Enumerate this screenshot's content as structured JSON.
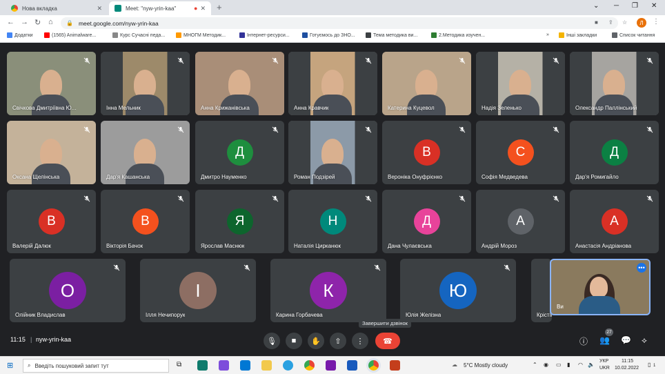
{
  "browser": {
    "tabs": [
      {
        "label": "Нова вкладка",
        "active": false
      },
      {
        "label": "Meet: \"nyw-yrin-kaa\"",
        "active": true
      }
    ],
    "url": "meet.google.com/nyw-yrin-kaa",
    "profile_initial": "Л",
    "bookmarks": [
      {
        "label": "Додатки",
        "color": "#4285f4"
      },
      {
        "label": "(1565) Animalware...",
        "color": "#ff0000"
      },
      {
        "label": "Курс Сучасні педа...",
        "color": "#888888"
      },
      {
        "label": "МНОГМ Методик...",
        "color": "#ff9900"
      },
      {
        "label": "Інтернет-ресурси...",
        "color": "#333399"
      },
      {
        "label": "Готуємось до ЗНО...",
        "color": "#1e4fa0"
      },
      {
        "label": "Тема методика ви...",
        "color": "#3c4043"
      },
      {
        "label": "2.Методика изучен...",
        "color": "#2e7d32"
      },
      {
        "label": "Інші закладки",
        "color": "#f4b400"
      },
      {
        "label": "Список читання",
        "color": "#5f6368"
      }
    ]
  },
  "meet": {
    "participants_video": [
      {
        "name": "Свічкова Дмитріївна Ю...",
        "bg": "#8a8f7a"
      },
      {
        "name": "Інна Мельник",
        "bg": "#9d8a6a"
      },
      {
        "name": "Анна Крижанівська",
        "bg": "#a98e78"
      },
      {
        "name": "Анна Кравчик",
        "bg": "#c5a47e"
      },
      {
        "name": "Катерина Куцевол",
        "bg": "#b9a48a"
      },
      {
        "name": "Надія Зеленько",
        "bg": "#b5b1a6"
      },
      {
        "name": "Олександр Паллінський",
        "bg": "#a6a4a0"
      },
      {
        "name": "Оксана Щелінська",
        "bg": "#c4b29a"
      },
      {
        "name": "Дар'я Кашанська",
        "bg": "#9c9c9c"
      },
      {
        "name": "Роман Подзірей",
        "bg": "#8c9aa8"
      }
    ],
    "participants_avatar": [
      {
        "name": "Дмитро Науменко",
        "letter": "Д",
        "color": "#1e8e3e"
      },
      {
        "name": "Вероніка Онуфрієнко",
        "letter": "В",
        "color": "#d93025"
      },
      {
        "name": "Софія Медведева",
        "letter": "С",
        "color": "#f4511e"
      },
      {
        "name": "Дар'я Ромигайло",
        "letter": "Д",
        "color": "#0b8043"
      },
      {
        "name": "Валерій Далюк",
        "letter": "В",
        "color": "#d93025"
      },
      {
        "name": "Вікторія Бачок",
        "letter": "В",
        "color": "#f4511e"
      },
      {
        "name": "Ярослав Маснюк",
        "letter": "Я",
        "color": "#0d652d"
      },
      {
        "name": "Наталія Цирканюк",
        "letter": "Н",
        "color": "#00897b"
      },
      {
        "name": "Дана Чулаєвська",
        "letter": "Д",
        "color": "#e8439a"
      },
      {
        "name": "Андрій Мороз",
        "letter": "А",
        "color": "#5f6368"
      },
      {
        "name": "Анастасія Андріанова",
        "letter": "А",
        "color": "#d93025"
      },
      {
        "name": "Олійник Владислав",
        "letter": "О",
        "color": "#7b1fa2"
      },
      {
        "name": "Ілля Нечипорук",
        "letter": "І",
        "color": "#8d6e63"
      },
      {
        "name": "Карина Горбачева",
        "letter": "К",
        "color": "#8e24aa"
      },
      {
        "name": "Юлія Желізна",
        "letter": "Ю",
        "color": "#1565c0"
      },
      {
        "name": "Крістіна",
        "letter": "",
        "color": "#3c4043"
      }
    ],
    "self_view": {
      "name": "Ви"
    },
    "time": "11:15",
    "meeting_code": "nyw-yrin-kaa",
    "end_call_tooltip": "Завершити дзвінок",
    "participant_count": "27"
  },
  "taskbar": {
    "search_placeholder": "Введіть пошуковий запит тут",
    "weather": "5°C  Mostly cloudy",
    "lang_top": "УКР",
    "lang_bottom": "UKR",
    "clock_time": "11:15",
    "clock_date": "10.02.2022",
    "notif_count": "1"
  },
  "colors": {
    "accent": "#1a73e8",
    "end_call": "#ea4335",
    "background": "#202124",
    "tile": "#3c4043"
  }
}
